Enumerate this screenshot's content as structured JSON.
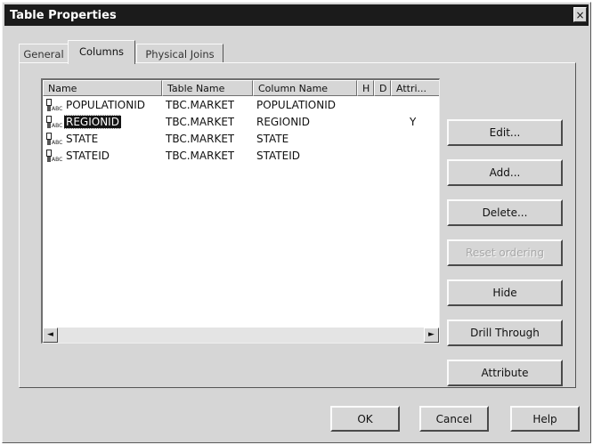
{
  "window": {
    "title": "Table Properties",
    "close_glyph": "×"
  },
  "tabs": [
    {
      "label": "General",
      "active": false
    },
    {
      "label": "Columns",
      "active": true
    },
    {
      "label": "Physical Joins",
      "active": false
    }
  ],
  "table": {
    "columns": [
      "Name",
      "Table Name",
      "Column Name",
      "H",
      "D",
      "Attri..."
    ],
    "rows": [
      {
        "icon": "column-type-icon",
        "name": "POPULATIONID",
        "table_name": "TBC.MARKET",
        "column_name": "POPULATIONID",
        "h": "",
        "d": "",
        "attr": "",
        "selected": false
      },
      {
        "icon": "column-type-icon",
        "name": "REGIONID",
        "table_name": "TBC.MARKET",
        "column_name": "REGIONID",
        "h": "",
        "d": "",
        "attr": "Y",
        "selected": true
      },
      {
        "icon": "column-type-icon",
        "name": "STATE",
        "table_name": "TBC.MARKET",
        "column_name": "STATE",
        "h": "",
        "d": "",
        "attr": "",
        "selected": false
      },
      {
        "icon": "column-type-icon",
        "name": "STATEID",
        "table_name": "TBC.MARKET",
        "column_name": "STATEID",
        "h": "",
        "d": "",
        "attr": "",
        "selected": false
      }
    ]
  },
  "scrollbar": {
    "left_arrow": "◄",
    "right_arrow": "►"
  },
  "side_buttons": {
    "edit": "Edit...",
    "add": "Add...",
    "delete": "Delete...",
    "reset_ordering": "Reset ordering",
    "hide": "Hide",
    "drill_through": "Drill Through",
    "attribute": "Attribute"
  },
  "footer": {
    "ok": "OK",
    "cancel": "Cancel",
    "help": "Help"
  },
  "colors": {
    "selection": "#141414",
    "titlebar": "#1b1b1b",
    "dialog_face": "#d6d6d6"
  }
}
